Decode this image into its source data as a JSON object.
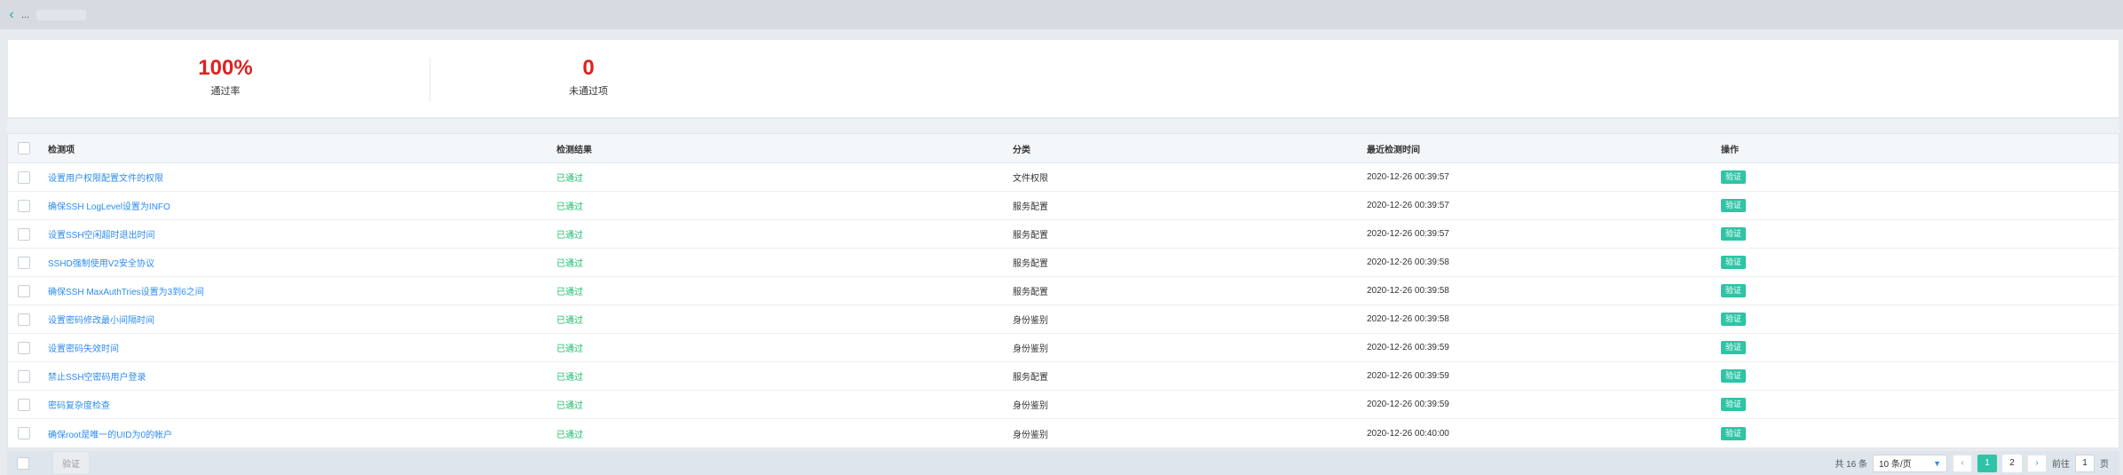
{
  "topbar": {
    "back_icon": "‹",
    "title": "..."
  },
  "summary": {
    "pass_rate_value": "100%",
    "pass_rate_label": "通过率",
    "failed_value": "0",
    "failed_label": "未通过项"
  },
  "table": {
    "headers": {
      "item": "检测项",
      "result": "检测结果",
      "category": "分类",
      "time": "最近检测时间",
      "action": "操作"
    },
    "rows": [
      {
        "item": "设置用户权限配置文件的权限",
        "result": "已通过",
        "category": "文件权限",
        "time": "2020-12-26 00:39:57",
        "action": "验证"
      },
      {
        "item": "确保SSH LogLevel设置为INFO",
        "result": "已通过",
        "category": "服务配置",
        "time": "2020-12-26 00:39:57",
        "action": "验证"
      },
      {
        "item": "设置SSH空闲超时退出时间",
        "result": "已通过",
        "category": "服务配置",
        "time": "2020-12-26 00:39:57",
        "action": "验证"
      },
      {
        "item": "SSHD强制使用V2安全协议",
        "result": "已通过",
        "category": "服务配置",
        "time": "2020-12-26 00:39:58",
        "action": "验证"
      },
      {
        "item": "确保SSH MaxAuthTries设置为3到6之间",
        "result": "已通过",
        "category": "服务配置",
        "time": "2020-12-26 00:39:58",
        "action": "验证"
      },
      {
        "item": "设置密码修改最小间隔时间",
        "result": "已通过",
        "category": "身份鉴别",
        "time": "2020-12-26 00:39:58",
        "action": "验证"
      },
      {
        "item": "设置密码失效时间",
        "result": "已通过",
        "category": "身份鉴别",
        "time": "2020-12-26 00:39:59",
        "action": "验证"
      },
      {
        "item": "禁止SSH空密码用户登录",
        "result": "已通过",
        "category": "服务配置",
        "time": "2020-12-26 00:39:59",
        "action": "验证"
      },
      {
        "item": "密码复杂度检查",
        "result": "已通过",
        "category": "身份鉴别",
        "time": "2020-12-26 00:39:59",
        "action": "验证"
      },
      {
        "item": "确保root是唯一的UID为0的帐户",
        "result": "已通过",
        "category": "身份鉴别",
        "time": "2020-12-26 00:40:00",
        "action": "验证"
      }
    ]
  },
  "footer": {
    "bulk_verify": "验证",
    "total": "共 16 条",
    "page_size": "10 条/页",
    "prev_icon": "‹",
    "next_icon": "›",
    "pages": [
      "1",
      "2"
    ],
    "goto_label": "前往",
    "goto_value": "1",
    "page_unit": "页"
  },
  "colors": {
    "accent": "#2ec4a5",
    "link": "#2d8cf0",
    "pass": "#19be6b",
    "danger": "#e02020"
  }
}
